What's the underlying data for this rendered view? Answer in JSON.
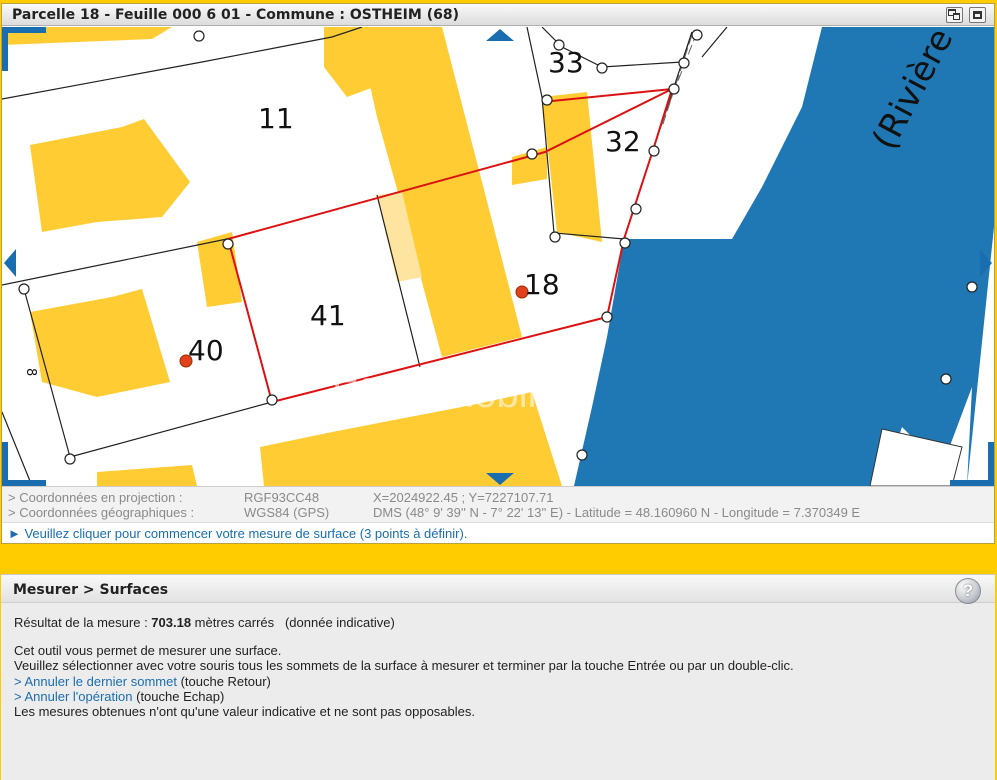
{
  "map_window": {
    "title": "Parcelle 18 - Feuille 000 6 01 - Commune : OSTHEIM (68)",
    "watermark": "Efikimmobilier",
    "labels": {
      "parcel_11": "11",
      "parcel_33": "33",
      "parcel_32": "32",
      "parcel_41": "41",
      "parcel_18": "18",
      "parcel_40": "40",
      "river": "(Rivière",
      "small_8": "8"
    },
    "colors": {
      "building": "#ffcc33",
      "water": "#1f77b4",
      "selection": "#dd1111",
      "accent": "#1a6eb0"
    }
  },
  "coordinates": {
    "projection_label": "> Coordonnées en projection :",
    "projection_system": "RGF93CC48",
    "projection_value": "X=2024922.45 ; Y=7227107.71",
    "geographic_label": "> Coordonnées géographiques :",
    "geographic_system": "WGS84 (GPS)",
    "geographic_value": "DMS (48° 9' 39'' N - 7° 22' 13'' E) - Latitude = 48.160960 N - Longitude = 7.370349 E"
  },
  "instruction": "► Veuillez cliquer pour commencer votre mesure de surface (3 points à définir).",
  "measure_panel": {
    "title": "Mesurer > Surfaces",
    "help_icon_text": "?",
    "result_prefix": "Résultat de la mesure : ",
    "result_value": "703.18",
    "result_suffix": " mètres carrés   (donnée indicative)",
    "description_line1": "Cet outil vous permet de mesurer une surface.",
    "description_line2": "Veuillez sélectionner avec votre souris tous les sommets de la surface à mesurer et terminer par la touche Entrée ou par un double-clic.",
    "undo_last_link": "> Annuler le dernier sommet",
    "undo_last_hint": " (touche Retour)",
    "cancel_link": "> Annuler l'opération",
    "cancel_hint": " (touche Echap)",
    "disclaimer": "Les mesures obtenues n'ont qu'une valeur indicative et ne sont pas opposables."
  }
}
